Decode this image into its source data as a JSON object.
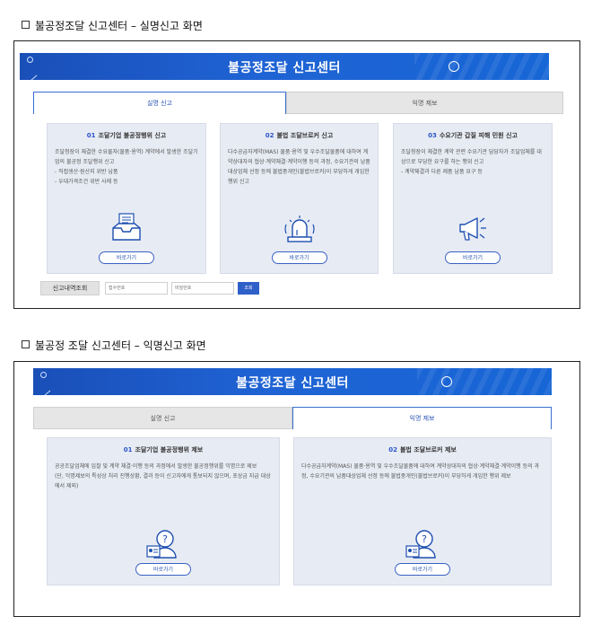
{
  "captions": {
    "real_name_screen": "불공정조달 신고센터 – 실명신고 화면",
    "anonymous_screen": "불공정 조달 신고센터 – 익명신고 화면"
  },
  "real_name": {
    "banner_title": "불공정조달 신고센터",
    "tabs": [
      "실명 신고",
      "익명 제보"
    ],
    "active_tab": "실명 신고",
    "cards": [
      {
        "num": "01",
        "title": "조달기업 불공정행위 신고",
        "body": "조달청장이 체결한 수요물자(물품·용역) 계약에서 발생한 조달기업의 불공정 조달행위 신고\n- 직접생산·원산지 위반 납품\n- 우대가격조건 위반 사례 등",
        "icon": "inbox-document-icon",
        "button": "바로가기"
      },
      {
        "num": "02",
        "title": "불법 조달브로커 신고",
        "body": "다수공급자계약(MAS) 물품·용역 및 우수조달물품에 대하여 계약상대자의 협상·계약체결·계약이행 등의 과정, 수요기관의 납품대상업체 선정 등에 불법중개인(불법브로커)이 부당하게 개입한 행위 신고",
        "icon": "siren-icon",
        "button": "바로가기"
      },
      {
        "num": "03",
        "title": "수요기관 갑질 피해 민원 신고",
        "body": "조달청장이 체결한 계약 관련 수요기관 담당자가 조달업체를 대상으로 부당한 요구를 하는 행위 신고\n- 계약체결과 다른 제품 납품 요구 등",
        "icon": "megaphone-icon",
        "button": "바로가기"
      }
    ],
    "lookup": {
      "label": "신고내역조회",
      "receipt_placeholder": "접수번호",
      "password_placeholder": "비밀번호",
      "button": "조회"
    }
  },
  "anonymous": {
    "banner_title": "불공정조달 신고센터",
    "tabs": [
      "실명 신고",
      "익명 제보"
    ],
    "active_tab": "익명 제보",
    "cards": [
      {
        "num": "01",
        "title": "조달기업 불공정행위 제보",
        "body": "공공조달업체에 입찰 및 계약 체결·이행 등의 과정에서 발생한 불공정행위를 익명으로 제보\n(단, 익명제보의 특성상 처리 진행상황, 결과 등이 신고자에게 통보되지 않으며, 포상금 지급 대상에서 제외)",
        "icon": "person-question-icon",
        "button": "바로가기"
      },
      {
        "num": "02",
        "title": "불법 조달브로커 제보",
        "body": "다수공급자계약(MAS) 물품·용역 및 우수조달물품에 대하여 계약상대자의 협상·계약체결·계약이행 등의 과정, 수요기관의 납품대상업체 선정 등에 불법중개인(불법브로커)이 부당하게 개입한 행위 제보",
        "icon": "person-question-icon",
        "button": "바로가기"
      }
    ]
  },
  "colors": {
    "banner": "#1f5fd0",
    "accent": "#2a55b8",
    "card_bg": "#e7ebf4"
  }
}
